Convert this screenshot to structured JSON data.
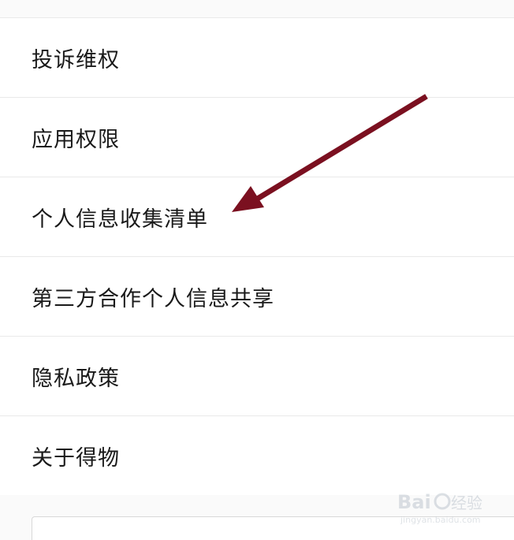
{
  "menu": {
    "items": [
      {
        "label": "投诉维权"
      },
      {
        "label": "应用权限"
      },
      {
        "label": "个人信息收集清单"
      },
      {
        "label": "第三方合作个人信息共享"
      },
      {
        "label": "隐私政策"
      },
      {
        "label": "关于得物"
      }
    ]
  },
  "annotation": {
    "arrow_color": "#7b1020",
    "arrow_icon": "arrow-icon"
  },
  "watermark": {
    "brand": "Baidu经验",
    "url": "jingyan.baidu.com"
  }
}
